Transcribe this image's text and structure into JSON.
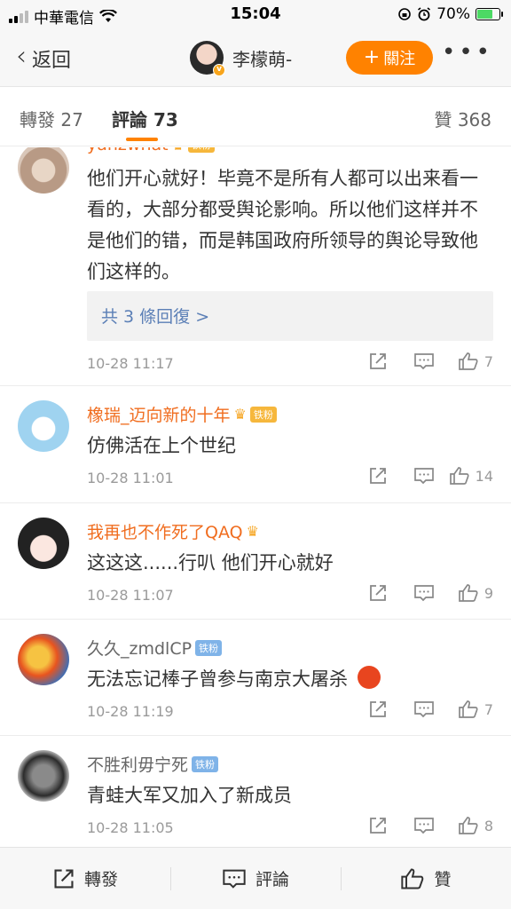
{
  "status_bar": {
    "carrier": "中華電信",
    "time": "15:04",
    "battery": "70%",
    "battery_level": 0.7
  },
  "nav": {
    "back_label": "返回",
    "user_name": "李檬萌-",
    "follow_label": "關注",
    "more_label": "•••"
  },
  "tabs": {
    "repost": "轉發 27",
    "comments": "評論 73",
    "likes": "贊 368"
  },
  "comments": [
    {
      "user": "yanzwhat",
      "badge": "铁粉",
      "text": "他们开心就好！毕竟不是所有人都可以出来看一看的，大部分都受舆论影响。所以他们这样并不是他们的错，而是韩国政府所领导的舆论导致他们这样的。",
      "replies_label": "共 3 條回復 >",
      "time": "10-28 11:17",
      "likes": "7"
    },
    {
      "user": "橡瑞_迈向新的十年",
      "badge": "铁粉",
      "text": "仿佛活在上个世纪",
      "time": "10-28 11:01",
      "likes": "14"
    },
    {
      "user": "我再也不作死了QAQ",
      "text": "这这这......行叭 他们开心就好",
      "time": "10-28 11:07",
      "likes": "9"
    },
    {
      "user": "久久_zmdlCP",
      "badge": "铁粉",
      "text": "无法忘记棒子曾参与南京大屠杀",
      "time": "10-28 11:19",
      "likes": "7"
    },
    {
      "user": "不胜利毋宁死",
      "badge": "铁粉",
      "text": "青蛙大军又加入了新成员",
      "time": "10-28 11:05",
      "likes": "8"
    }
  ],
  "bottom_bar": {
    "repost": "轉發",
    "comment": "評論",
    "like": "贊"
  },
  "colors": {
    "accent": "#ff8200",
    "link": "#5b7fb6",
    "username_orange": "#f06d1f"
  }
}
